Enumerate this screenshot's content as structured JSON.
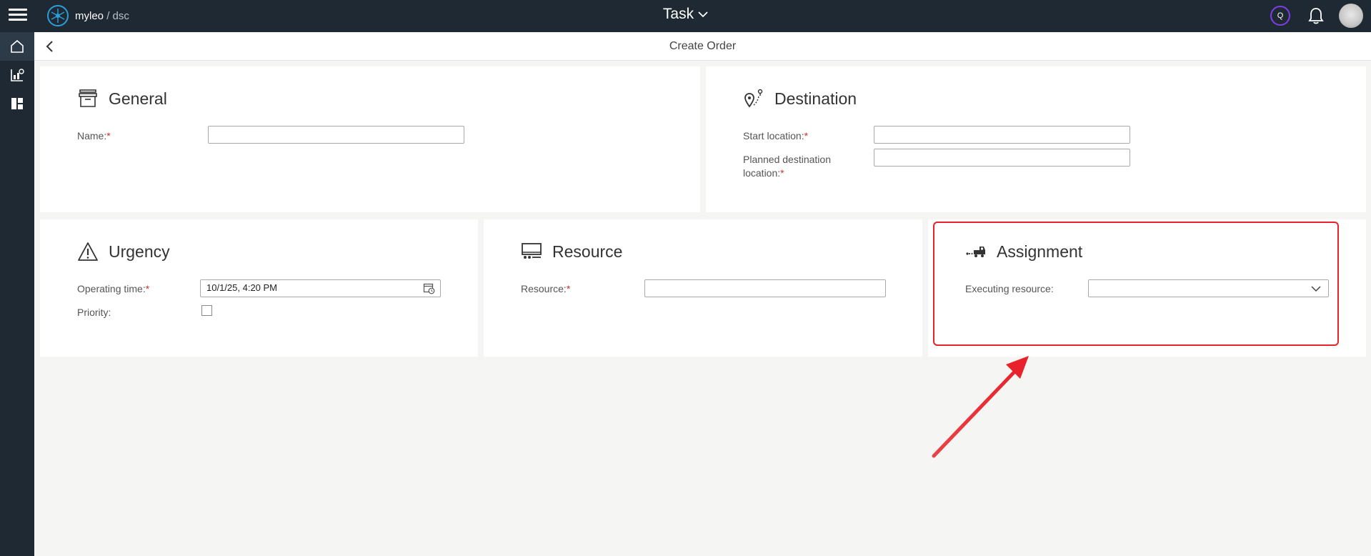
{
  "app": {
    "logo_brand": "myleo",
    "logo_sep": "/",
    "logo_product": "dsc",
    "title": "Task",
    "q_badge": "Q"
  },
  "page": {
    "title": "Create Order"
  },
  "sections": {
    "general": {
      "title": "General",
      "name_label": "Name:",
      "name_value": ""
    },
    "destination": {
      "title": "Destination",
      "start_label": "Start location:",
      "start_value": "",
      "planned_label_1": "Planned destination",
      "planned_label_2": "location:",
      "planned_value": ""
    },
    "urgency": {
      "title": "Urgency",
      "operating_label": "Operating time:",
      "operating_value": "10/1/25, 4:20 PM",
      "priority_label": "Priority:",
      "priority_checked": false
    },
    "resource": {
      "title": "Resource",
      "resource_label": "Resource:",
      "resource_value": ""
    },
    "assignment": {
      "title": "Assignment",
      "executing_label": "Executing resource:",
      "executing_value": ""
    }
  },
  "required_marker": "*",
  "colors": {
    "topbar": "#1f2933",
    "required": "#c0392b",
    "highlight": "#e8222a"
  },
  "icons": [
    "menu-icon",
    "logo-icon",
    "chevron-down-icon",
    "bell-icon",
    "home-icon",
    "chart-icon",
    "dashboard-icon",
    "back-icon",
    "archive-box-icon",
    "route-pin-icon",
    "warning-icon",
    "monitor-icon",
    "truck-icon",
    "calendar-icon",
    "dropdown-chevron-icon"
  ]
}
